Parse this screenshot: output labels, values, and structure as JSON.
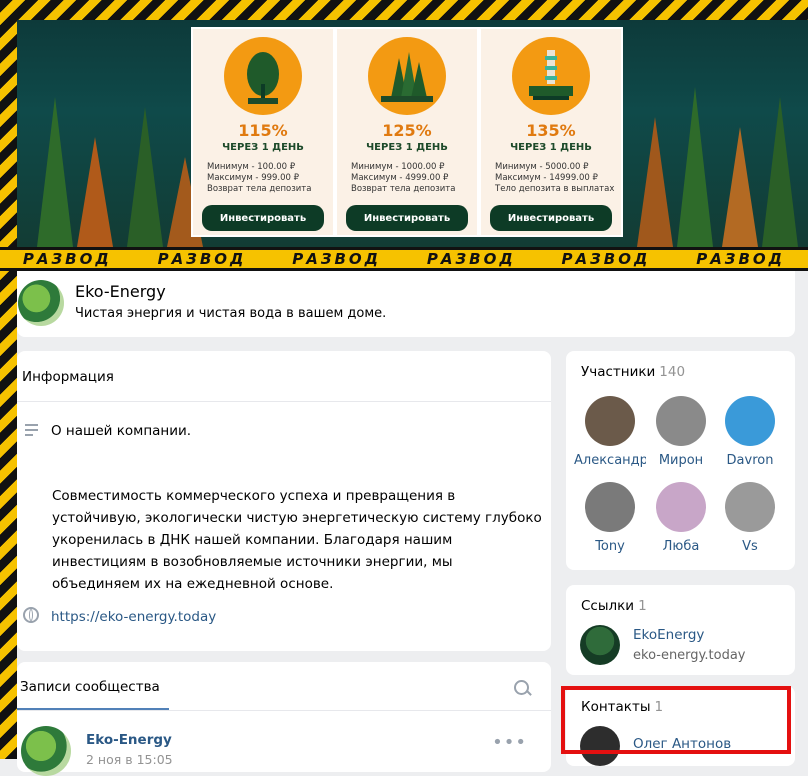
{
  "banner": {
    "warning_word": "РАЗВОД",
    "offers": [
      {
        "percent": "115%",
        "term": "ЧЕРЕЗ 1 ДЕНЬ",
        "min": "Минимум - 100.00 ₽",
        "max": "Максимум - 999.00 ₽",
        "note": "Возврат тела депозита",
        "button": "Инвестировать"
      },
      {
        "percent": "125%",
        "term": "ЧЕРЕЗ 1 ДЕНЬ",
        "min": "Минимум - 1000.00 ₽",
        "max": "Максимум - 4999.00 ₽",
        "note": "Возврат тела депозита",
        "button": "Инвестировать"
      },
      {
        "percent": "135%",
        "term": "ЧЕРЕЗ 1 ДЕНЬ",
        "min": "Минимум - 5000.00 ₽",
        "max": "Максимум - 14999.00 ₽",
        "note": "Тело депозита в выплатах",
        "button": "Инвестировать"
      }
    ]
  },
  "group": {
    "name": "Eko-Energy",
    "status": "Чистая энергия и чистая вода в вашем доме."
  },
  "info": {
    "title": "Информация",
    "about_label": "О нашей компании.",
    "description": "Совместимость коммерческого успеха и превращения в устойчивую, экологически чистую энергетическую систему глубоко укоренилась в ДНК нашей компании. Благодаря нашим инвестициям в возобновляемые источники энергии, мы объединяем их на ежедневной основе.",
    "website": "https://eko-energy.today"
  },
  "posts": {
    "tab_label": "Записи сообщества",
    "author": "Eko-Energy",
    "date": "2 ноя в 15:05"
  },
  "members": {
    "title": "Участники",
    "count": "140",
    "list": [
      {
        "name": "Александр",
        "color": "#6b5a4a"
      },
      {
        "name": "Мирон",
        "color": "#8a8a8a"
      },
      {
        "name": "Davron",
        "color": "#3a9ad9"
      },
      {
        "name": "Tony",
        "color": "#7a7a7a"
      },
      {
        "name": "Люба",
        "color": "#c8a6c8"
      },
      {
        "name": "Vs",
        "color": "#9a9a9a"
      }
    ]
  },
  "links": {
    "title": "Ссылки",
    "count": "1",
    "name": "EkoEnergy",
    "url": "eko-energy.today"
  },
  "contacts": {
    "title": "Контакты",
    "count": "1",
    "name": "Олег Антонов"
  }
}
